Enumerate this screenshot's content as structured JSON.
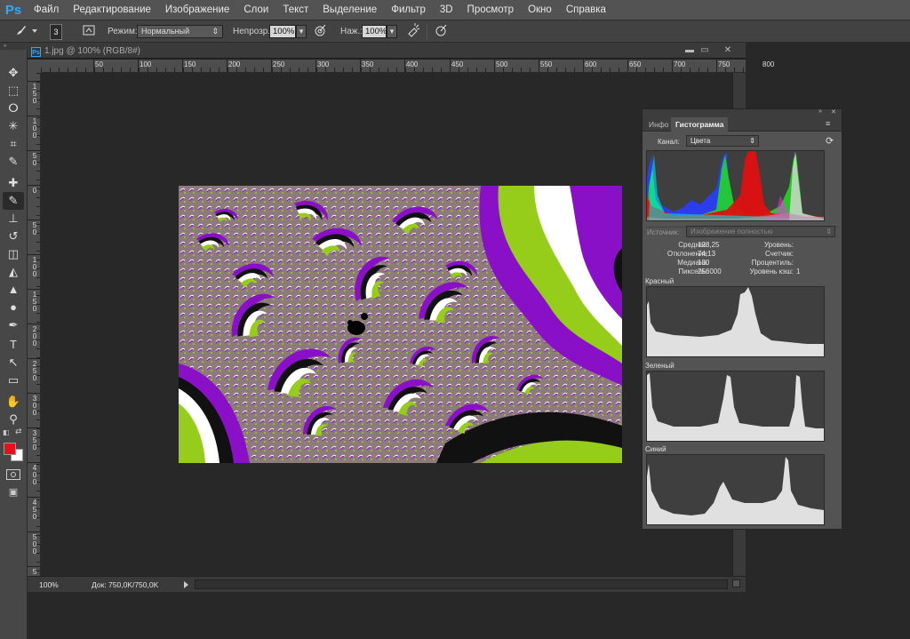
{
  "app": {
    "logo": "Ps",
    "menu": [
      "Файл",
      "Редактирование",
      "Изображение",
      "Слои",
      "Текст",
      "Выделение",
      "Фильтр",
      "3D",
      "Просмотр",
      "Окно",
      "Справка"
    ]
  },
  "options_bar": {
    "brush_size": "3",
    "mode_label": "Режим:",
    "mode_value": "Нормальный",
    "opacity_label": "Непрозр.:",
    "opacity_value": "100%",
    "pressure_label": "Наж.:",
    "pressure_value": "100%"
  },
  "tools": [
    "move-tool",
    "rect-marquee-tool",
    "lasso-tool",
    "magic-wand-tool",
    "crop-tool",
    "eyedropper-tool",
    "healing-brush-tool",
    "brush-tool",
    "clone-stamp-tool",
    "history-brush-tool",
    "eraser-tool",
    "paint-bucket-tool",
    "blur-tool",
    "dodge-tool",
    "pen-tool",
    "type-tool",
    "path-select-tool",
    "rectangle-tool",
    "hand-tool",
    "zoom-tool"
  ],
  "tools_glyphs": [
    "✥",
    "⬚",
    "ⵔ",
    "✳",
    "⌗",
    "✎",
    "✚",
    "✎",
    "⊥",
    "↺",
    "◫",
    "◭",
    "▲",
    "●",
    "✒",
    "T",
    "↖",
    "▭",
    "✋",
    "⚲"
  ],
  "colors": {
    "foreground": "#e8101c",
    "background": "#ffffff",
    "accent": "#31a8ff"
  },
  "document": {
    "tab_title": "1.jpg @ 100% (RGB/8#)",
    "zoom": "100%",
    "status": "Док: 750,0K/750,0K",
    "ruler_h": [
      "50",
      "100",
      "150",
      "200",
      "250",
      "300",
      "350",
      "400",
      "450",
      "500",
      "550",
      "600",
      "650",
      "700",
      "750",
      "800"
    ],
    "ruler_v": [
      "1 5 0",
      "1 0 0",
      "5 0",
      "0",
      "5 0",
      "1 0 0",
      "1 5 0",
      "2 0 0",
      "2 5 0",
      "3 0 0",
      "3 5 0",
      "4 0 0",
      "4 5 0",
      "5 0 0",
      "5 5 0"
    ]
  },
  "histogram_panel": {
    "tabs": [
      "Инфо",
      "Гистограмма"
    ],
    "channel_label": "Канал:",
    "channel_value": "Цвета",
    "source_label": "Источник:",
    "source_value": "Изображение полностью",
    "stats": {
      "mean_label": "Среднее:",
      "mean": "123,25",
      "std_label": "Отклонение:",
      "std": "74,13",
      "median_label": "Медиана:",
      "median": "130",
      "pixels_label": "Пикселы:",
      "pixels": "256000",
      "level_label": "Уровень:",
      "level": "",
      "count_label": "Счетчик:",
      "count": "",
      "percentile_label": "Процентиль:",
      "percentile": "",
      "cache_label": "Уровень кэш:",
      "cache": "1"
    },
    "red_label": "Красный",
    "green_label": "Зеленый",
    "blue_label": "Синий"
  }
}
